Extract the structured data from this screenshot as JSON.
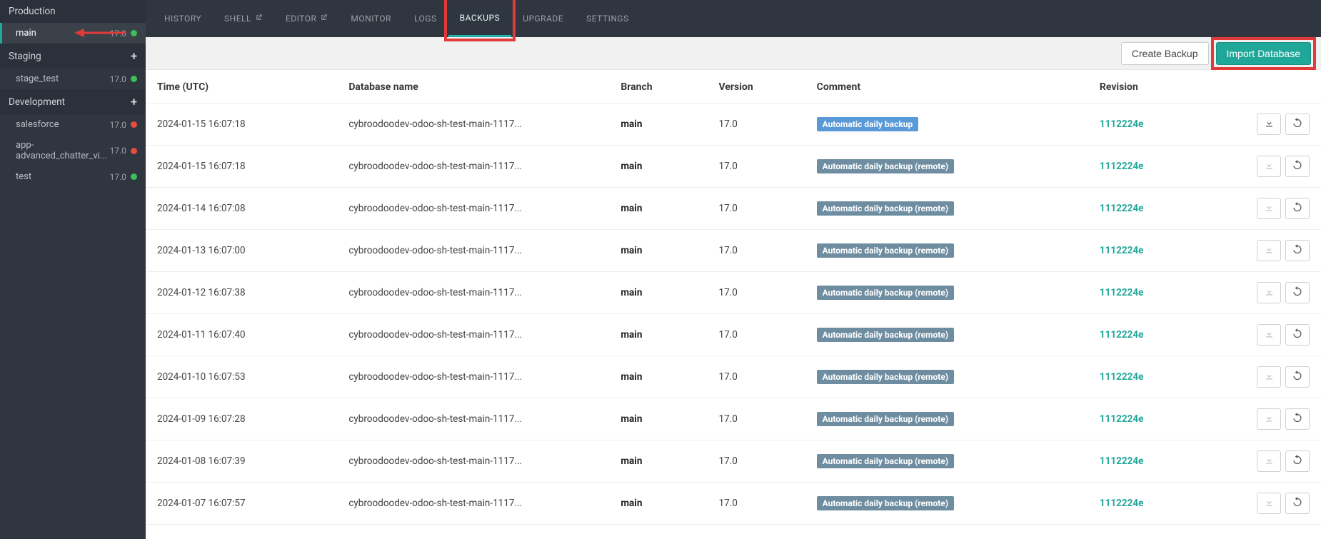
{
  "sidebar": {
    "sections": [
      {
        "title": "Production",
        "has_add": false,
        "items": [
          {
            "name": "main",
            "version": "17.0",
            "status": "green",
            "active": true
          }
        ]
      },
      {
        "title": "Staging",
        "has_add": true,
        "items": [
          {
            "name": "stage_test",
            "version": "17.0",
            "status": "green",
            "active": false
          }
        ]
      },
      {
        "title": "Development",
        "has_add": true,
        "items": [
          {
            "name": "salesforce",
            "version": "17.0",
            "status": "red",
            "active": false
          },
          {
            "name": "app-advanced_chatter_vi...",
            "version": "17.0",
            "status": "red",
            "active": false
          },
          {
            "name": "test",
            "version": "17.0",
            "status": "green",
            "active": false
          }
        ]
      }
    ]
  },
  "topnav": {
    "tabs": [
      {
        "label": "HISTORY",
        "ext": false,
        "active": false
      },
      {
        "label": "SHELL",
        "ext": true,
        "active": false
      },
      {
        "label": "EDITOR",
        "ext": true,
        "active": false
      },
      {
        "label": "MONITOR",
        "ext": false,
        "active": false
      },
      {
        "label": "LOGS",
        "ext": false,
        "active": false
      },
      {
        "label": "BACKUPS",
        "ext": false,
        "active": true,
        "highlighted": true
      },
      {
        "label": "UPGRADE",
        "ext": false,
        "active": false
      },
      {
        "label": "SETTINGS",
        "ext": false,
        "active": false
      }
    ]
  },
  "toolbar": {
    "create_label": "Create Backup",
    "import_label": "Import Database",
    "import_highlighted": true
  },
  "table": {
    "headers": {
      "time": "Time (UTC)",
      "db": "Database name",
      "branch": "Branch",
      "version": "Version",
      "comment": "Comment",
      "revision": "Revision"
    },
    "rows": [
      {
        "time": "2024-01-15 16:07:18",
        "db": "cybroodoodev-odoo-sh-test-main-1117...",
        "branch": "main",
        "version": "17.0",
        "comment": "Automatic daily backup",
        "comment_style": "local",
        "revision": "1112224e",
        "download_enabled": true
      },
      {
        "time": "2024-01-15 16:07:18",
        "db": "cybroodoodev-odoo-sh-test-main-1117...",
        "branch": "main",
        "version": "17.0",
        "comment": "Automatic daily backup (remote)",
        "comment_style": "remote",
        "revision": "1112224e",
        "download_enabled": false
      },
      {
        "time": "2024-01-14 16:07:08",
        "db": "cybroodoodev-odoo-sh-test-main-1117...",
        "branch": "main",
        "version": "17.0",
        "comment": "Automatic daily backup (remote)",
        "comment_style": "remote",
        "revision": "1112224e",
        "download_enabled": false
      },
      {
        "time": "2024-01-13 16:07:00",
        "db": "cybroodoodev-odoo-sh-test-main-1117...",
        "branch": "main",
        "version": "17.0",
        "comment": "Automatic daily backup (remote)",
        "comment_style": "remote",
        "revision": "1112224e",
        "download_enabled": false
      },
      {
        "time": "2024-01-12 16:07:38",
        "db": "cybroodoodev-odoo-sh-test-main-1117...",
        "branch": "main",
        "version": "17.0",
        "comment": "Automatic daily backup (remote)",
        "comment_style": "remote",
        "revision": "1112224e",
        "download_enabled": false
      },
      {
        "time": "2024-01-11 16:07:40",
        "db": "cybroodoodev-odoo-sh-test-main-1117...",
        "branch": "main",
        "version": "17.0",
        "comment": "Automatic daily backup (remote)",
        "comment_style": "remote",
        "revision": "1112224e",
        "download_enabled": false
      },
      {
        "time": "2024-01-10 16:07:53",
        "db": "cybroodoodev-odoo-sh-test-main-1117...",
        "branch": "main",
        "version": "17.0",
        "comment": "Automatic daily backup (remote)",
        "comment_style": "remote",
        "revision": "1112224e",
        "download_enabled": false
      },
      {
        "time": "2024-01-09 16:07:28",
        "db": "cybroodoodev-odoo-sh-test-main-1117...",
        "branch": "main",
        "version": "17.0",
        "comment": "Automatic daily backup (remote)",
        "comment_style": "remote",
        "revision": "1112224e",
        "download_enabled": false
      },
      {
        "time": "2024-01-08 16:07:39",
        "db": "cybroodoodev-odoo-sh-test-main-1117...",
        "branch": "main",
        "version": "17.0",
        "comment": "Automatic daily backup (remote)",
        "comment_style": "remote",
        "revision": "1112224e",
        "download_enabled": false
      },
      {
        "time": "2024-01-07 16:07:57",
        "db": "cybroodoodev-odoo-sh-test-main-1117...",
        "branch": "main",
        "version": "17.0",
        "comment": "Automatic daily backup (remote)",
        "comment_style": "remote",
        "revision": "1112224e",
        "download_enabled": false
      }
    ]
  },
  "annotations": {
    "arrow_to_main": true
  },
  "colors": {
    "accent": "#1fa799",
    "highlight": "#e03a3a",
    "badge_remote": "#6f8da1",
    "badge_local": "#5a99d8"
  }
}
